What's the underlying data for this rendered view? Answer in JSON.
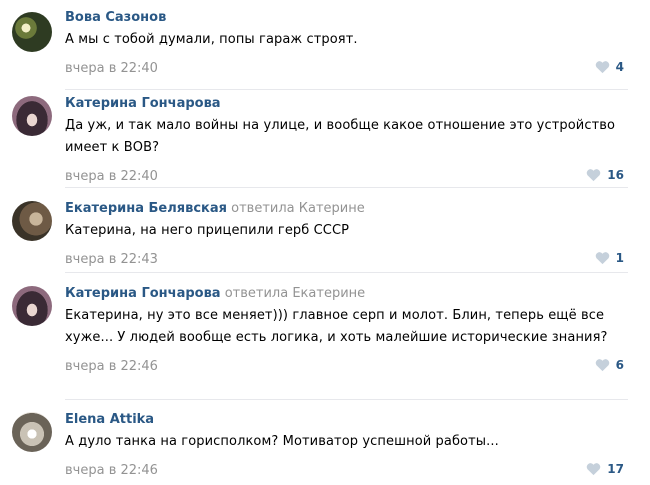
{
  "comments": [
    {
      "author": "Вова Сазонов",
      "reply_prefix": "",
      "reply_to": "",
      "text": "А мы с тобой думали, попы гараж строят.",
      "date": "вчера в 22:40",
      "likes": "4",
      "avatar_icon": "avatar-photo-icon"
    },
    {
      "author": "Катерина Гончарова",
      "reply_prefix": "",
      "reply_to": "",
      "text": "Да уж, и так мало войны на улице, и вообще какое отношение это устройство имеет к ВОВ?",
      "date": "вчера в 22:40",
      "likes": "16",
      "avatar_icon": "avatar-photo-icon"
    },
    {
      "author": "Екатерина Белявская",
      "reply_prefix": "ответила",
      "reply_to": "Катерине",
      "text": "Катерина, на него прицепили герб СССР",
      "date": "вчера в 22:43",
      "likes": "1",
      "avatar_icon": "avatar-photo-icon"
    },
    {
      "author": "Катерина Гончарова",
      "reply_prefix": "ответила",
      "reply_to": "Екатерине",
      "text": "Екатерина, ну это все меняет))) главное серп и молот. Блин, теперь ещё все хуже... У людей вообще есть логика, и хоть малейшие исторические знания?",
      "date": "вчера в 22:46",
      "likes": "6",
      "avatar_icon": "avatar-photo-icon"
    },
    {
      "author": "Elena Attika",
      "reply_prefix": "",
      "reply_to": "",
      "text": "А дуло танка на горисполком? Мотиватор успешной работы...",
      "date": "вчера в 22:46",
      "likes": "17",
      "avatar_icon": "avatar-photo-icon"
    }
  ],
  "colors": {
    "author": "#2a5885",
    "muted": "#939393",
    "like_icon": "#c5d0db",
    "divider": "#e7e8ec"
  },
  "icons": {
    "like": "heart-icon"
  }
}
